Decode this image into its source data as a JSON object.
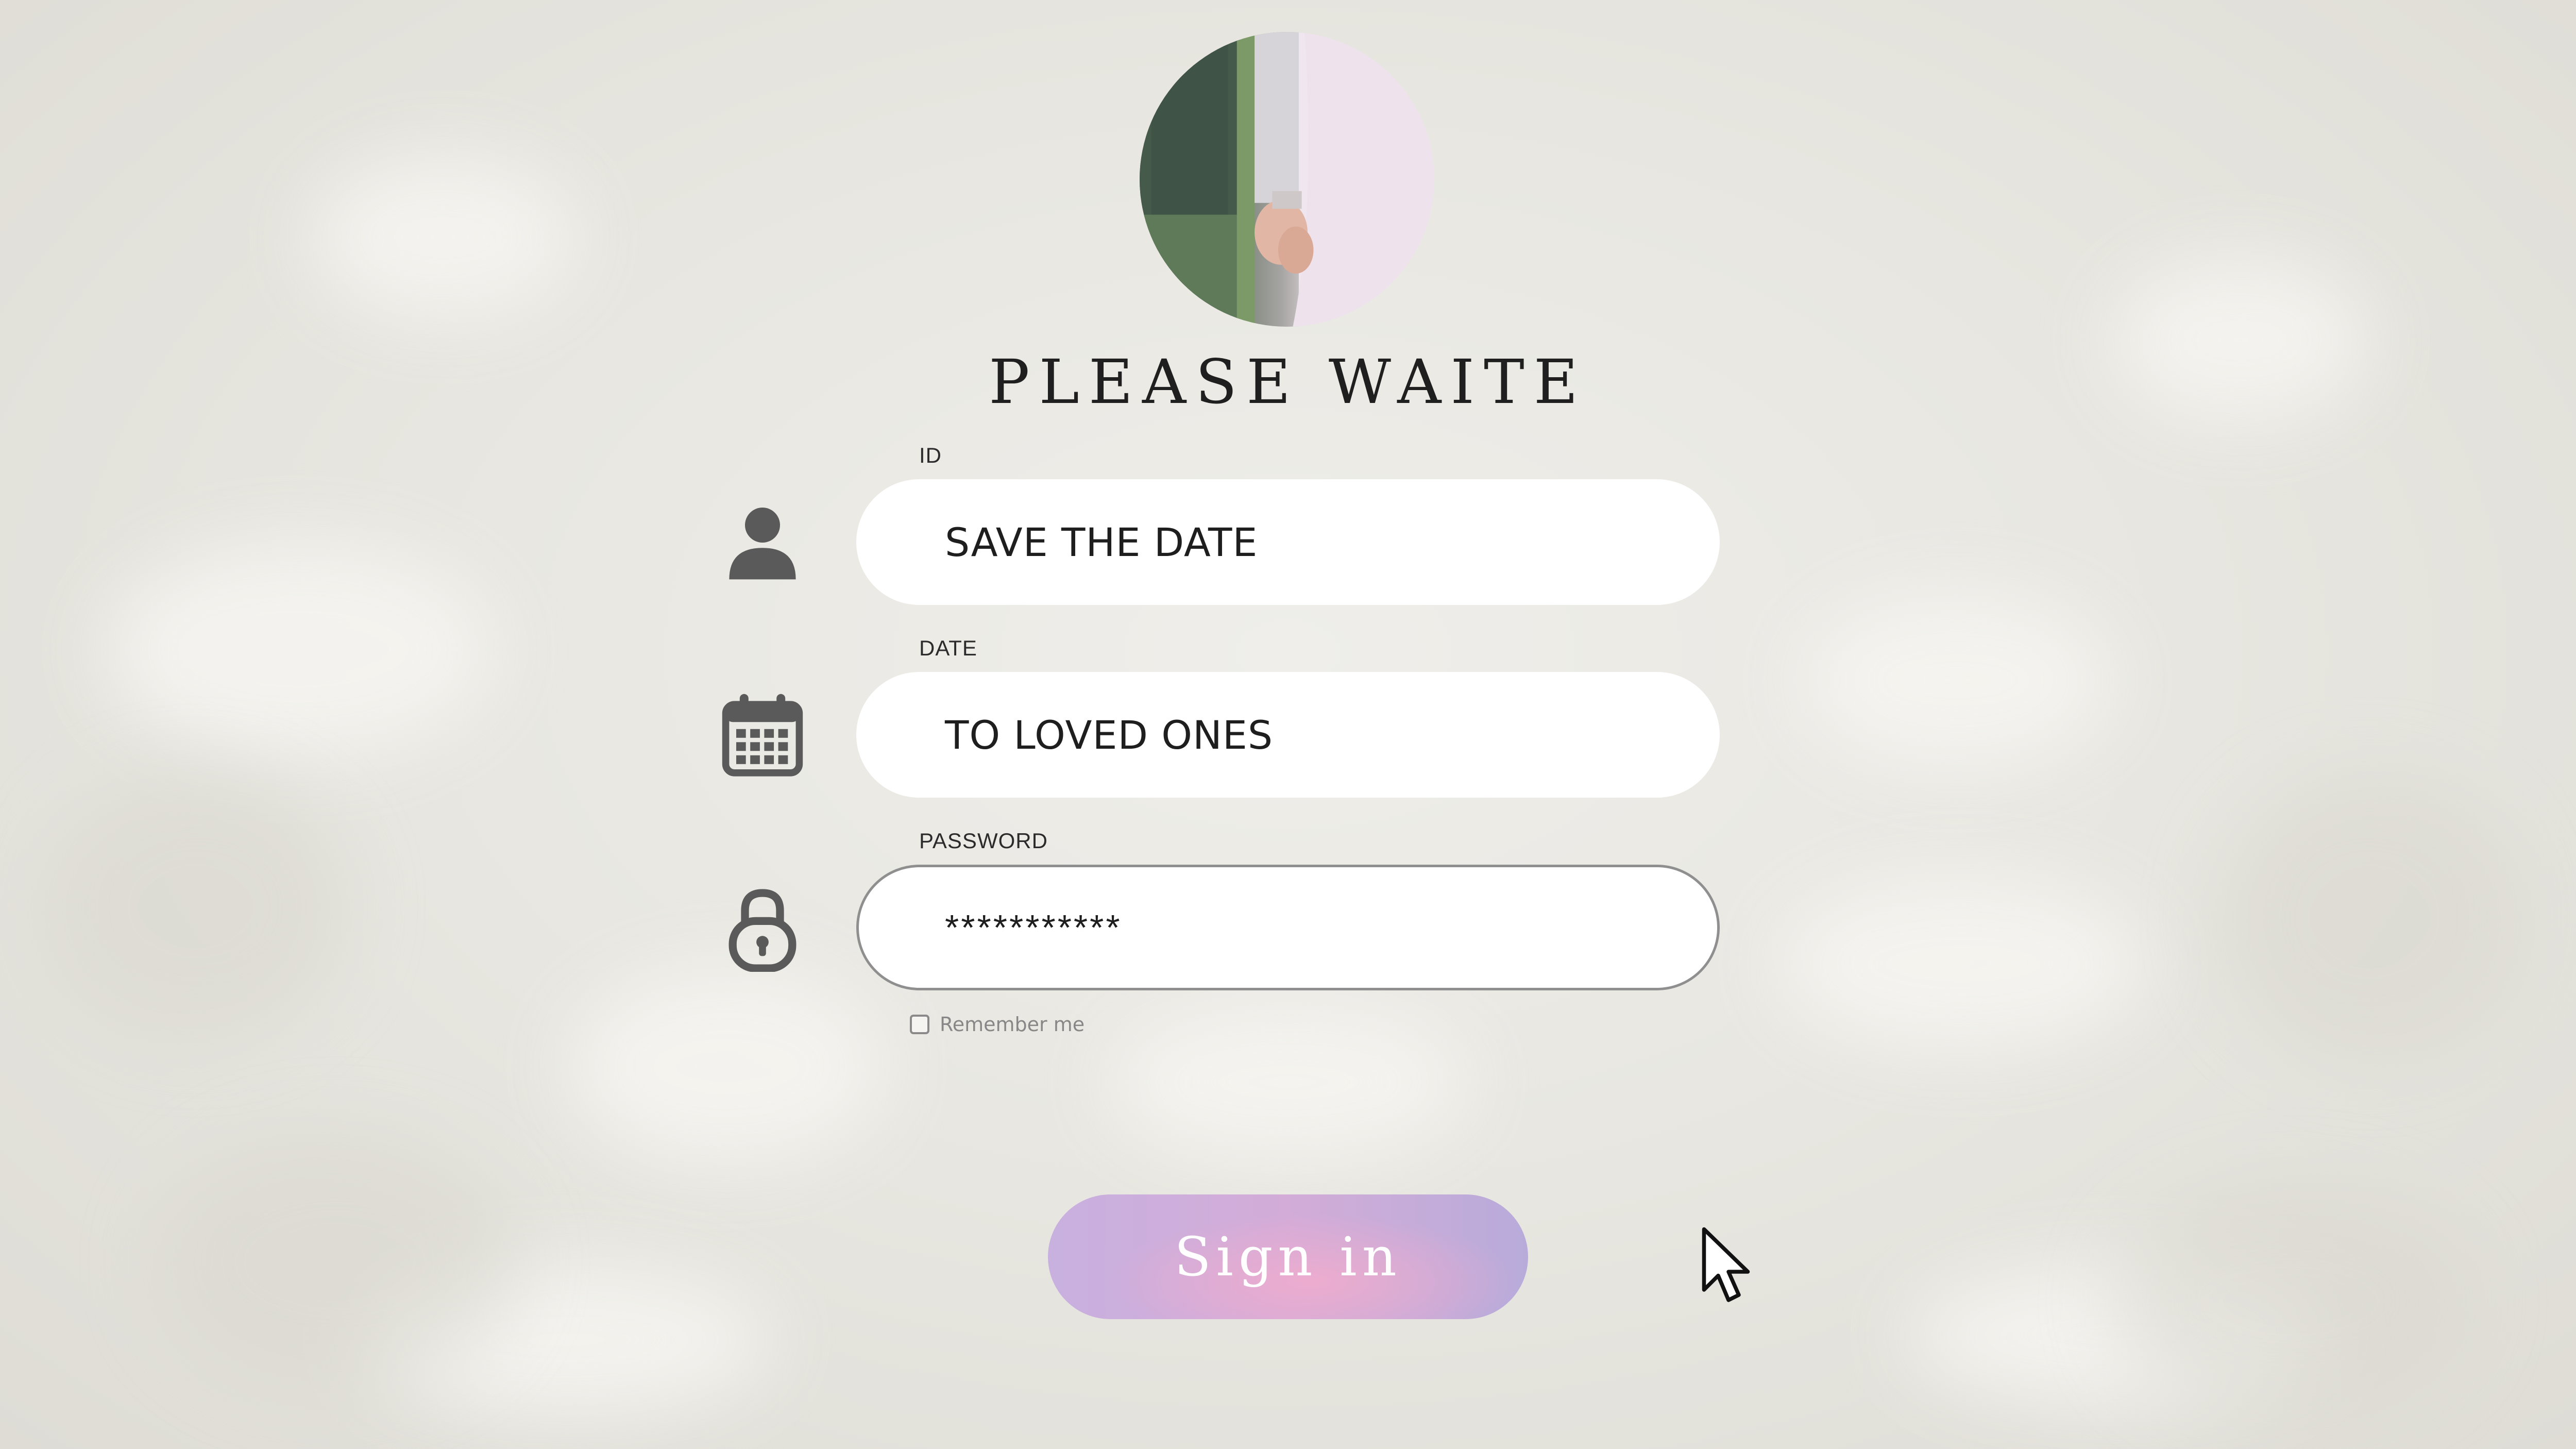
{
  "title": "PLEASE WAITE",
  "avatar": {
    "icon": "couple-holding-hands-photo"
  },
  "fields": {
    "id": {
      "label": "ID",
      "value": "SAVE  THE DATE",
      "icon": "user-icon"
    },
    "date": {
      "label": "DATE",
      "value": "TO LOVED ONES",
      "icon": "calendar-icon"
    },
    "password": {
      "label": "PASSWORD",
      "value": "***********",
      "icon": "lock-icon"
    }
  },
  "remember": {
    "label": "Remember me",
    "checked": false
  },
  "signin": {
    "label": "Sign in"
  },
  "colors": {
    "background": "#e6e5df",
    "field": "#ffffff",
    "icon": "#5a5a5a",
    "button_start": "#c8b0df",
    "button_mid": "#eeacce",
    "button_end": "#b8abda"
  }
}
